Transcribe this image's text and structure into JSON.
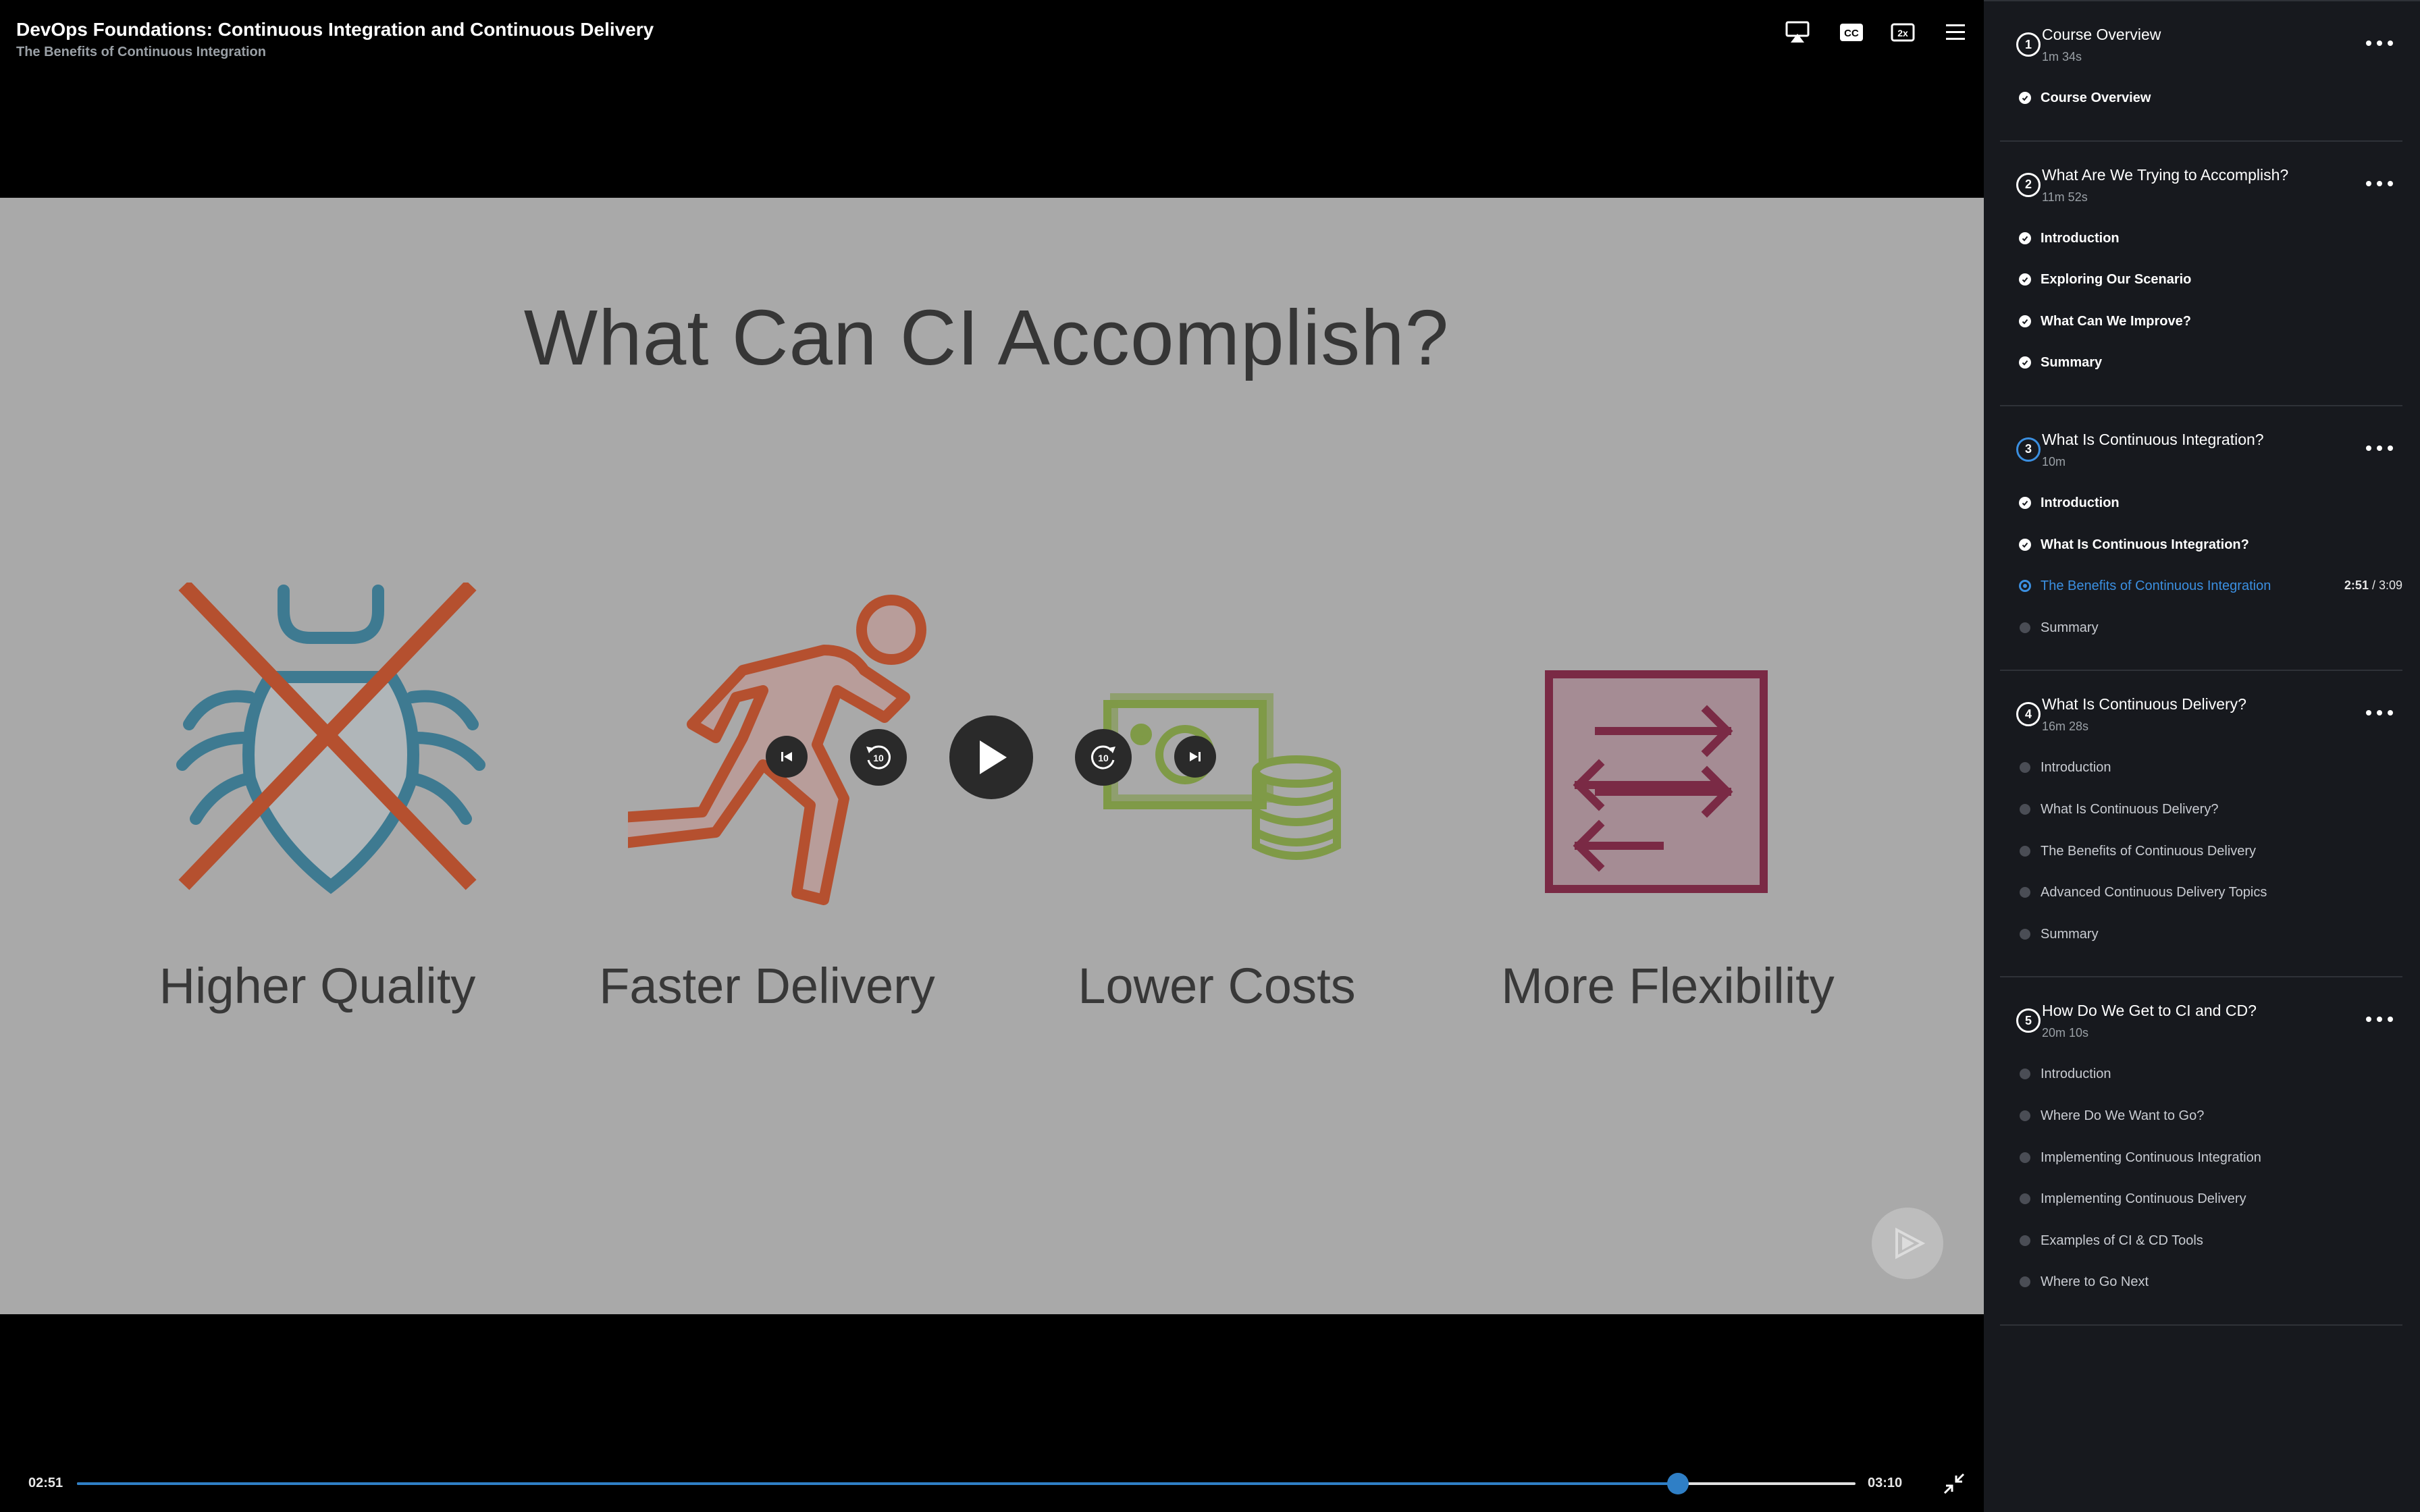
{
  "header": {
    "course_title": "DevOps Foundations: Continuous Integration and Continuous Delivery",
    "clip_title": "The Benefits of Continuous Integration",
    "icons": [
      "airplay-icon",
      "closed-captions-icon",
      "playback-speed-icon",
      "menu-icon"
    ],
    "speed_label": "2x",
    "cc_label": "CC"
  },
  "slide": {
    "title": "What Can CI Accomplish?",
    "benefits": [
      {
        "label": "Higher Quality",
        "icon": "bug-crossed-out-icon",
        "color": "#3e7a91"
      },
      {
        "label": "Faster Delivery",
        "icon": "running-person-icon",
        "color": "#b5502f"
      },
      {
        "label": "Lower Costs",
        "icon": "money-coins-icon",
        "color": "#7f9a47"
      },
      {
        "label": "More Flexibility",
        "icon": "flexibility-arrows-icon",
        "color": "#7a2a45"
      }
    ],
    "skip_back_label": "10",
    "skip_forward_label": "10"
  },
  "playback": {
    "current_time": "02:51",
    "total_time": "03:10",
    "progress_fraction": 0.9,
    "accent": "#2f7fc6"
  },
  "sidebar": {
    "modules": [
      {
        "number": "1",
        "title": "Course Overview",
        "duration": "1m 34s",
        "state": "done",
        "clips": [
          {
            "title": "Course Overview",
            "state": "watched"
          }
        ]
      },
      {
        "number": "2",
        "title": "What Are We Trying to Accomplish?",
        "duration": "11m 52s",
        "state": "done",
        "clips": [
          {
            "title": "Introduction",
            "state": "watched"
          },
          {
            "title": "Exploring Our Scenario",
            "state": "watched"
          },
          {
            "title": "What Can We Improve?",
            "state": "watched"
          },
          {
            "title": "Summary",
            "state": "watched"
          }
        ]
      },
      {
        "number": "3",
        "title": "What Is Continuous Integration?",
        "duration": "10m",
        "state": "current",
        "clips": [
          {
            "title": "Introduction",
            "state": "watched"
          },
          {
            "title": "What Is Continuous Integration?",
            "state": "watched"
          },
          {
            "title": "The Benefits of Continuous Integration",
            "state": "current",
            "progress_elapsed": "2:51",
            "progress_total": " / 3:09"
          },
          {
            "title": "Summary",
            "state": "pending"
          }
        ]
      },
      {
        "number": "4",
        "title": "What Is Continuous Delivery?",
        "duration": "16m 28s",
        "state": "todo",
        "clips": [
          {
            "title": "Introduction",
            "state": "pending"
          },
          {
            "title": "What Is Continuous Delivery?",
            "state": "pending"
          },
          {
            "title": "The Benefits of Continuous Delivery",
            "state": "pending"
          },
          {
            "title": "Advanced Continuous Delivery Topics",
            "state": "pending"
          },
          {
            "title": "Summary",
            "state": "pending"
          }
        ]
      },
      {
        "number": "5",
        "title": "How Do We Get to CI and CD?",
        "duration": "20m 10s",
        "state": "todo",
        "clips": [
          {
            "title": "Introduction",
            "state": "pending"
          },
          {
            "title": "Where Do We Want to Go?",
            "state": "pending"
          },
          {
            "title": "Implementing Continuous Integration",
            "state": "pending"
          },
          {
            "title": "Implementing Continuous Delivery",
            "state": "pending"
          },
          {
            "title": "Examples of CI & CD Tools",
            "state": "pending"
          },
          {
            "title": "Where to Go Next",
            "state": "pending"
          }
        ]
      }
    ],
    "current_color": "#3b8fe0"
  }
}
